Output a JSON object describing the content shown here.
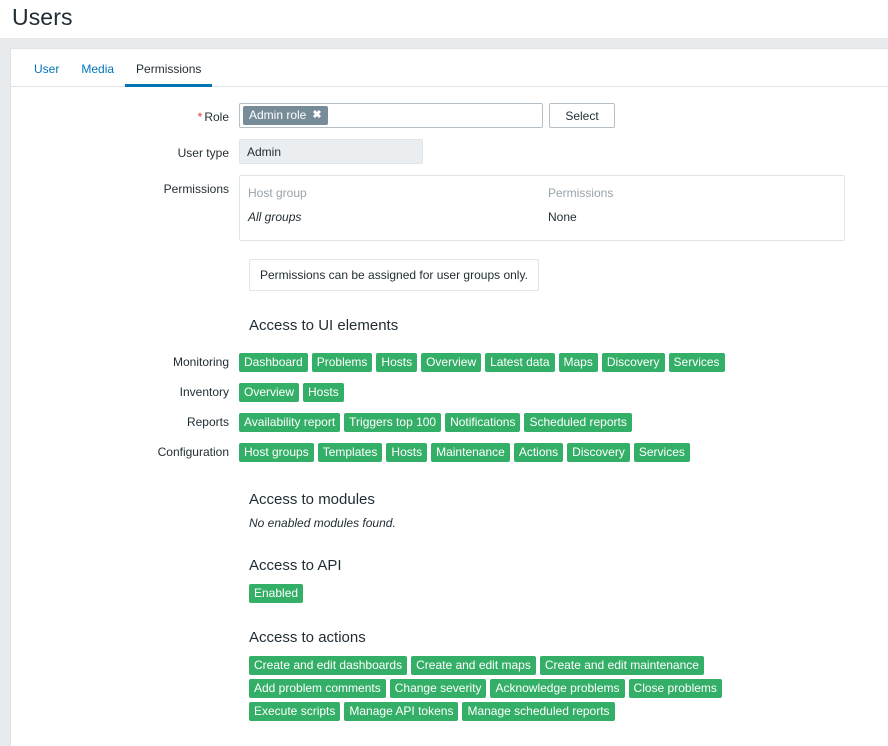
{
  "header": {
    "title": "Users"
  },
  "tabs": [
    {
      "label": "User",
      "active": false
    },
    {
      "label": "Media",
      "active": false
    },
    {
      "label": "Permissions",
      "active": true
    }
  ],
  "form": {
    "role": {
      "label": "Role",
      "required_marker": "*",
      "chip_value": "Admin role",
      "chip_remove_icon": "close-icon",
      "select_button": "Select"
    },
    "user_type": {
      "label": "User type",
      "value": "Admin"
    },
    "permissions": {
      "label": "Permissions",
      "columns": [
        "Host group",
        "Permissions"
      ],
      "rows": [
        {
          "host_group": "All groups",
          "permission": "None"
        }
      ],
      "note": "Permissions can be assigned for user groups only."
    }
  },
  "ui_elements": {
    "heading": "Access to UI elements",
    "groups": [
      {
        "label": "Monitoring",
        "tags": [
          "Dashboard",
          "Problems",
          "Hosts",
          "Overview",
          "Latest data",
          "Maps",
          "Discovery",
          "Services"
        ]
      },
      {
        "label": "Inventory",
        "tags": [
          "Overview",
          "Hosts"
        ]
      },
      {
        "label": "Reports",
        "tags": [
          "Availability report",
          "Triggers top 100",
          "Notifications",
          "Scheduled reports"
        ]
      },
      {
        "label": "Configuration",
        "tags": [
          "Host groups",
          "Templates",
          "Hosts",
          "Maintenance",
          "Actions",
          "Discovery",
          "Services"
        ]
      }
    ]
  },
  "modules": {
    "heading": "Access to modules",
    "empty_message": "No enabled modules found."
  },
  "api": {
    "heading": "Access to API",
    "status_tag": "Enabled"
  },
  "actions": {
    "heading": "Access to actions",
    "lines": [
      [
        "Create and edit dashboards",
        "Create and edit maps",
        "Create and edit maintenance"
      ],
      [
        "Add problem comments",
        "Change severity",
        "Acknowledge problems",
        "Close problems"
      ],
      [
        "Execute scripts",
        "Manage API tokens",
        "Manage scheduled reports"
      ]
    ]
  },
  "colors": {
    "accent_blue": "#0275b8",
    "tag_green": "#34af67",
    "chip_gray": "#768d99",
    "required_red": "#e33734",
    "page_bg": "#e8ebee",
    "text": "#1f2c33"
  }
}
